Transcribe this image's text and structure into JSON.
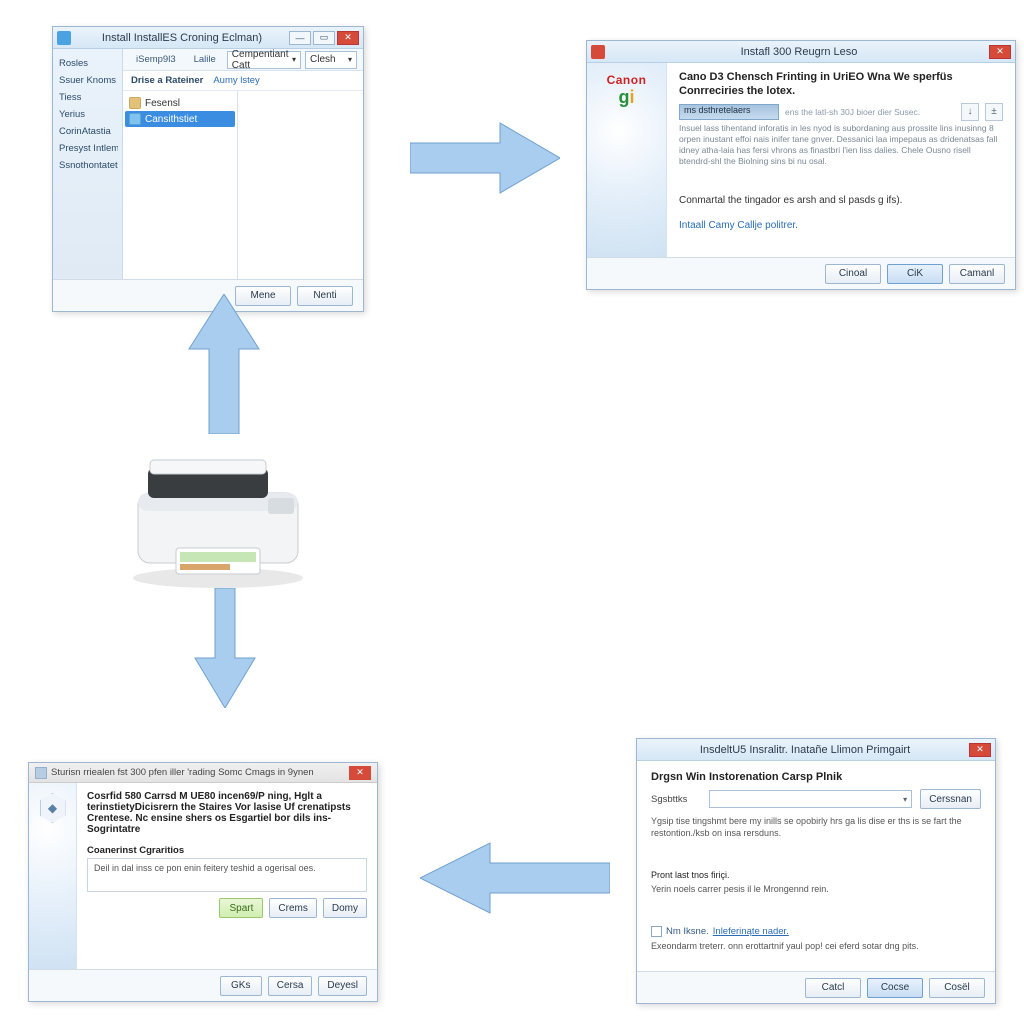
{
  "colors": {
    "accent": "#3a8de0",
    "link": "#2a6db5",
    "close": "#d64a3a"
  },
  "win1": {
    "title": "Install InstallES Croning Eclman)",
    "sidebar": [
      "Rosles",
      "Ssuer Knoms",
      "Tiess",
      "Yerius",
      "CorinAtastia",
      "Presyst Intlems",
      "Ssnothontatet"
    ],
    "toolbar": {
      "tab1": "iSemp9l3",
      "tab2": "Lalile",
      "combo": "Cempentiant Catt",
      "combo2": "Clesh"
    },
    "filter": {
      "label": "Drise a Rateiner",
      "link": "Aumy lstey"
    },
    "tree": {
      "node0": "Fesensl",
      "node1": "Cansithstiet"
    },
    "footer": {
      "b1": "Mene",
      "b2": "Nenti"
    }
  },
  "win2": {
    "title": "Instafl 300 Reugrn Leso",
    "brand_top": "Canon",
    "brand_g": "gi",
    "heading": "Cano D3 Chensch Frinting in UriEO Wna We sperfüs Conrreciries the lotex.",
    "search_chip": "ms dsthretelaers",
    "search_hint": "ens the latl-sh 30J bioer dier Susec.",
    "para": "Insuel lass tihentand inforatis in les nyod is subordaning aus prossite lins inusinng 8 orpen inustant effoi nais inifer tane gnver. Dessanici laa impepaus as dridenatsas fall idney atha-laia has fersi vhrons as finastbri l'ien liss dalies. Chele Ousno risell btendrd-shl the Biolning sins bi nu osal.",
    "mid": "Conmartal the tingador es arsh and sl pasds g ifs).",
    "link": "Intaall Camy Callje politrer.",
    "footer": {
      "b1": "Cinoal",
      "b2": "CiK",
      "b3": "Camanl"
    },
    "sq1": "↓",
    "sq2": "±"
  },
  "win3": {
    "title": "Sturisn rriealen fst 300 pfen iller 'rading Somc Cmags in 9ynen",
    "bold": "Cosrfid 580 Carrsd M UE80 incen69/P ning, Hglt a terinstietyDicisrern the Staires Vor lasise Uf crenatipsts Crentese. Nc ensine shers os Esgartiel bor dils ins-Sogrintatre",
    "group_label": "Coanerinst Cgraritios",
    "group_text": "Deil in dal inss ce pon enin feitery teshid a ogerisal oes.",
    "row_btns": {
      "b1": "Spart",
      "b2": "Crems",
      "b3": "Domy"
    },
    "footer": {
      "b1": "GKs",
      "b2": "Cersa",
      "b3": "Deyesl"
    }
  },
  "win4": {
    "title": "InsdeltU5 Insralitr. Inatañe Llimon Primgairt",
    "heading": "Drgsn Win Instorenation Carsp Plnik",
    "dropdown_label": "Sgsbttks",
    "dropdown_btn": "Cerssnan",
    "para1": "Ygsip tise tingshmt bere my inills se opobirly hrs ga lis dise er ths is se fart the restontion./ksb on insa rersduns.",
    "mid1": "Pront last tnos firiçi.",
    "mid2": "Yerin noels carrer pesis il le Mrongennd rein.",
    "chk_label": "Nm Iksne.",
    "chk_link": "Inleferinąte nader.",
    "note": "Exeondarm treterr. onn erottartnif yaul pop! cei eferd sotar dng pits.",
    "footer": {
      "b1": "Catcl",
      "b2": "Cocse",
      "b3": "Cosël"
    }
  }
}
